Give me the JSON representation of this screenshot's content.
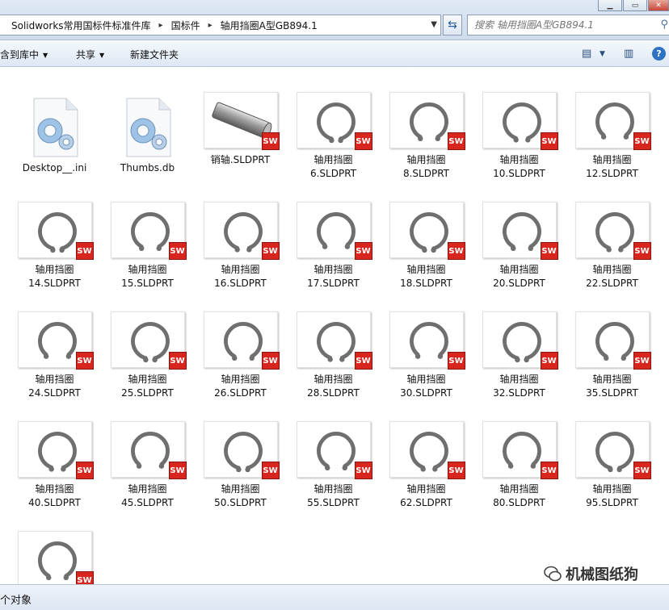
{
  "address_bar": {
    "breadcrumbs": [
      "Solidworks常用国标件标准件库",
      "国标件",
      "轴用挡圈A型GB894.1"
    ],
    "search_placeholder": "搜索 轴用挡圈A型GB894.1"
  },
  "toolbar": {
    "include_in_library": "含到库中",
    "share": "共享",
    "new_folder": "新建文件夹"
  },
  "files": [
    {
      "line1": "Desktop__.ini",
      "line2": "",
      "kind": "config-file"
    },
    {
      "line1": "Thumbs.db",
      "line2": "",
      "kind": "config-file"
    },
    {
      "line1": "销轴.SLDPRT",
      "line2": "",
      "kind": "pin-part"
    },
    {
      "line1": "轴用挡圈",
      "line2": "6.SLDPRT",
      "kind": "ring-part"
    },
    {
      "line1": "轴用挡圈",
      "line2": "8.SLDPRT",
      "kind": "ring-part"
    },
    {
      "line1": "轴用挡圈",
      "line2": "10.SLDPRT",
      "kind": "ring-part"
    },
    {
      "line1": "轴用挡圈",
      "line2": "12.SLDPRT",
      "kind": "ring-part"
    },
    {
      "line1": "轴用挡圈",
      "line2": "14.SLDPRT",
      "kind": "ring-part"
    },
    {
      "line1": "轴用挡圈",
      "line2": "15.SLDPRT",
      "kind": "ring-part"
    },
    {
      "line1": "轴用挡圈",
      "line2": "16.SLDPRT",
      "kind": "ring-part"
    },
    {
      "line1": "轴用挡圈",
      "line2": "17.SLDPRT",
      "kind": "ring-part"
    },
    {
      "line1": "轴用挡圈",
      "line2": "18.SLDPRT",
      "kind": "ring-part"
    },
    {
      "line1": "轴用挡圈",
      "line2": "20.SLDPRT",
      "kind": "ring-part"
    },
    {
      "line1": "轴用挡圈",
      "line2": "22.SLDPRT",
      "kind": "ring-part"
    },
    {
      "line1": "轴用挡圈",
      "line2": "24.SLDPRT",
      "kind": "ring-part"
    },
    {
      "line1": "轴用挡圈",
      "line2": "25.SLDPRT",
      "kind": "ring-part"
    },
    {
      "line1": "轴用挡圈",
      "line2": "26.SLDPRT",
      "kind": "ring-part"
    },
    {
      "line1": "轴用挡圈",
      "line2": "28.SLDPRT",
      "kind": "ring-part"
    },
    {
      "line1": "轴用挡圈",
      "line2": "30.SLDPRT",
      "kind": "ring-part"
    },
    {
      "line1": "轴用挡圈",
      "line2": "32.SLDPRT",
      "kind": "ring-part"
    },
    {
      "line1": "轴用挡圈",
      "line2": "35.SLDPRT",
      "kind": "ring-part"
    },
    {
      "line1": "轴用挡圈",
      "line2": "40.SLDPRT",
      "kind": "ring-part"
    },
    {
      "line1": "轴用挡圈",
      "line2": "45.SLDPRT",
      "kind": "ring-part"
    },
    {
      "line1": "轴用挡圈",
      "line2": "50.SLDPRT",
      "kind": "ring-part"
    },
    {
      "line1": "轴用挡圈",
      "line2": "55.SLDPRT",
      "kind": "ring-part"
    },
    {
      "line1": "轴用挡圈",
      "line2": "62.SLDPRT",
      "kind": "ring-part"
    },
    {
      "line1": "轴用挡圈",
      "line2": "80.SLDPRT",
      "kind": "ring-part"
    },
    {
      "line1": "轴用挡圈",
      "line2": "95.SLDPRT",
      "kind": "ring-part"
    },
    {
      "line1": "",
      "line2": "",
      "kind": "ring-part"
    }
  ],
  "sw_badge_text": "SW",
  "status_bar": {
    "text": "个对象"
  },
  "watermark": {
    "text": "机械图纸狗"
  },
  "colors": {
    "sw_badge": "#d8251d",
    "ring": "#6f6f6f",
    "toolbar_bg": "#dde8f4"
  }
}
